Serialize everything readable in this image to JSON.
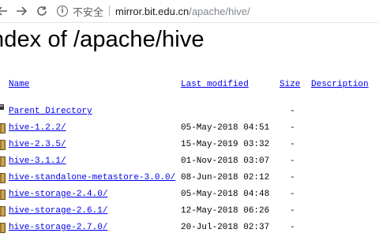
{
  "browser": {
    "security_label": "不安全",
    "url_host": "mirror.bit.edu.cn",
    "url_path": "/apache/hive/"
  },
  "page": {
    "title": "ndex of /apache/hive"
  },
  "table": {
    "headers": {
      "name": "Name",
      "last_modified": "Last modified",
      "size": "Size",
      "description": "Description"
    },
    "parent": {
      "name": "Parent Directory",
      "size": "-"
    },
    "rows": [
      {
        "name": "hive-1.2.2/",
        "date": "05-May-2018 04:51",
        "size": "-"
      },
      {
        "name": "hive-2.3.5/",
        "date": "15-May-2019 03:32",
        "size": "-"
      },
      {
        "name": "hive-3.1.1/",
        "date": "01-Nov-2018 03:07",
        "size": "-"
      },
      {
        "name": "hive-standalone-metastore-3.0.0/",
        "date": "08-Jun-2018 02:12",
        "size": "-"
      },
      {
        "name": "hive-storage-2.4.0/",
        "date": "05-May-2018 04:48",
        "size": "-"
      },
      {
        "name": "hive-storage-2.6.1/",
        "date": "12-May-2018 06:26",
        "size": "-"
      },
      {
        "name": "hive-storage-2.7.0/",
        "date": "20-Jul-2018 02:37",
        "size": "-"
      }
    ]
  },
  "icons": {
    "back": "arrow-left-icon",
    "forward": "arrow-right-icon",
    "reload": "reload-icon",
    "info": "info-icon",
    "folder": "folder-icon",
    "parent": "back-folder-icon"
  },
  "colors": {
    "link": "#0000ee"
  }
}
